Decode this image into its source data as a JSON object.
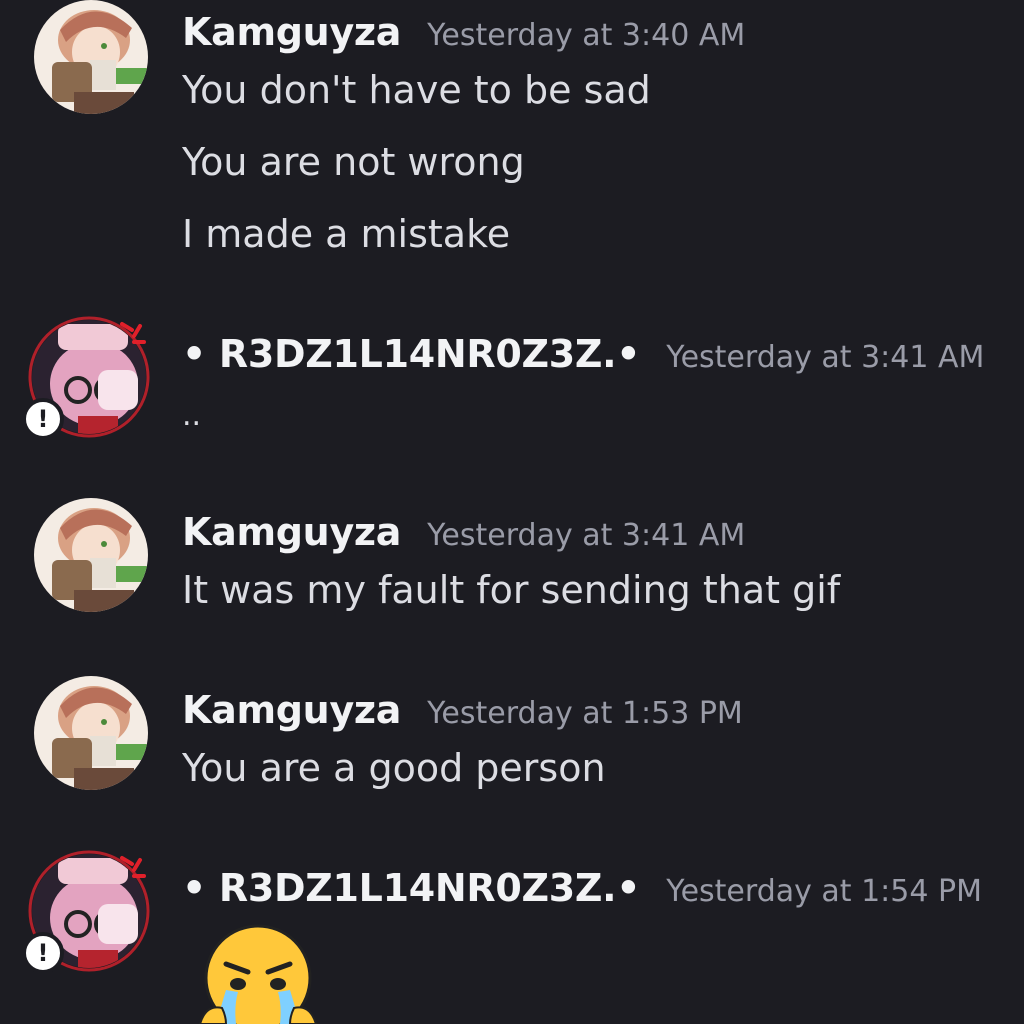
{
  "messages": [
    {
      "author": "Kamguyza",
      "timestamp": "Yesterday at 3:40 AM",
      "lines": [
        "You don't have to be sad",
        "You are not wrong",
        "I made a mistake"
      ]
    },
    {
      "author": "• R3DZ1L14NR0Z3Z.•",
      "timestamp": "Yesterday at 3:41 AM",
      "lines": [
        ".."
      ]
    },
    {
      "author": "Kamguyza",
      "timestamp": "Yesterday at 3:41 AM",
      "lines": [
        "It was my fault for sending that gif"
      ]
    },
    {
      "author": "Kamguyza",
      "timestamp": "Yesterday at 1:53 PM",
      "lines": [
        "You are a good person"
      ]
    },
    {
      "author": "• R3DZ1L14NR0Z3Z.•",
      "timestamp": "Yesterday at 1:54 PM",
      "lines": []
    }
  ],
  "icons": {
    "kamguyza_avatar": "kamguyza-avatar",
    "redzilian_avatar": "redzilian-avatar",
    "status_badge": "!",
    "emoji": "crying-angry-emoji"
  },
  "colors": {
    "background": "#1c1c22",
    "username": "#f2f3f5",
    "timestamp": "#9a9ca8",
    "message_text": "#dcdde3"
  }
}
